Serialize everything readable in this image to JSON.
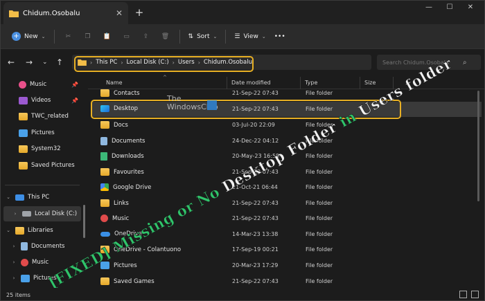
{
  "window": {
    "tab_title": "Chidum.Osobalu",
    "tab_close": "✕",
    "new_tab": "+",
    "minimize": "—",
    "maximize": "☐",
    "close": "✕"
  },
  "toolbar": {
    "new_label": "New",
    "sort_label": "Sort",
    "view_label": "View",
    "more_label": "•••"
  },
  "address": {
    "crumbs": [
      "This PC",
      "Local Disk (C:)",
      "Users",
      "Chidum.Osobalu"
    ],
    "search_placeholder": "Search Chidum.Osobalu"
  },
  "sidebar": {
    "items": [
      {
        "label": "Music",
        "icon": "music-icon",
        "pinned": true
      },
      {
        "label": "Videos",
        "icon": "videos-icon",
        "pinned": true
      },
      {
        "label": "TWC_related",
        "icon": "folder-icon",
        "pinned": false
      },
      {
        "label": "Pictures",
        "icon": "pictures-icon",
        "pinned": false
      },
      {
        "label": "System32",
        "icon": "folder-icon",
        "pinned": false
      },
      {
        "label": "Saved Pictures",
        "icon": "folder-icon",
        "pinned": false
      },
      {
        "label": "This PC",
        "icon": "pc-icon",
        "pinned": false
      },
      {
        "label": "Local Disk (C:)",
        "icon": "drive-icon",
        "pinned": false
      },
      {
        "label": "Libraries",
        "icon": "folder-icon",
        "pinned": false
      },
      {
        "label": "Documents",
        "icon": "documents-icon",
        "pinned": false
      },
      {
        "label": "Music",
        "icon": "music-icon",
        "pinned": false
      },
      {
        "label": "Pictures",
        "icon": "pictures-icon",
        "pinned": false
      }
    ]
  },
  "columns": {
    "name": "Name",
    "date": "Date modified",
    "type": "Type",
    "size": "Size"
  },
  "files": [
    {
      "name": "Contacts",
      "date": "21-Sep-22 07:43",
      "type": "File folder",
      "icon": "contacts-folder-icon"
    },
    {
      "name": "Desktop",
      "date": "21-Sep-22 07:43",
      "type": "File folder",
      "icon": "desktop-icon"
    },
    {
      "name": "Docs",
      "date": "03-Jul-20 22:09",
      "type": "File folder",
      "icon": "folder-icon"
    },
    {
      "name": "Documents",
      "date": "24-Dec-22 04:12",
      "type": "File folder",
      "icon": "documents-icon"
    },
    {
      "name": "Downloads",
      "date": "20-May-23 16:58",
      "type": "File folder",
      "icon": "downloads-icon"
    },
    {
      "name": "Favourites",
      "date": "21-Sep-22 07:43",
      "type": "File folder",
      "icon": "folder-icon"
    },
    {
      "name": "Google Drive",
      "date": "21-Oct-21 06:44",
      "type": "File folder",
      "icon": "google-drive-icon"
    },
    {
      "name": "Links",
      "date": "21-Sep-22 07:43",
      "type": "File folder",
      "icon": "folder-icon"
    },
    {
      "name": "Music",
      "date": "21-Sep-22 07:43",
      "type": "File folder",
      "icon": "music-icon"
    },
    {
      "name": "OneDrive",
      "date": "14-Mar-23 13:38",
      "type": "File folder",
      "icon": "onedrive-icon"
    },
    {
      "name": "OneDrive - Colantuono",
      "date": "17-Sep-19 00:21",
      "type": "File folder",
      "icon": "folder-icon"
    },
    {
      "name": "Pictures",
      "date": "20-Mar-23 17:29",
      "type": "File folder",
      "icon": "pictures-icon"
    },
    {
      "name": "Saved Games",
      "date": "21-Sep-22 07:43",
      "type": "File folder",
      "icon": "saved-games-icon"
    }
  ],
  "status": {
    "item_count": "25 items"
  },
  "watermark": {
    "line1": "The",
    "line2": "WindowsClub"
  },
  "overlay_title": {
    "part1": "[FIXED] Missing or No ",
    "part2": "Desktop Folder ",
    "part3": "in ",
    "part4": "Users folder"
  },
  "colors": {
    "highlight": "#e8b024",
    "title_green": "#2fc46a"
  }
}
